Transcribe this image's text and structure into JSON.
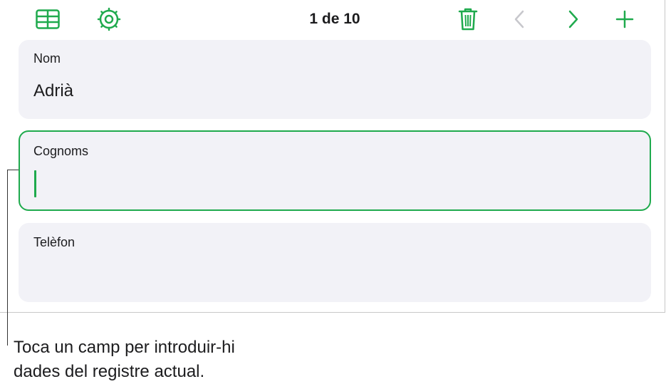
{
  "toolbar": {
    "record_counter": "1 de 10",
    "icons": {
      "table": "table-icon",
      "settings": "gear-icon",
      "delete": "trash-icon",
      "previous": "chevron-left-icon",
      "next": "chevron-right-icon",
      "add": "plus-icon"
    }
  },
  "fields": [
    {
      "label": "Nom",
      "value": "Adrià",
      "active": false
    },
    {
      "label": "Cognoms",
      "value": "",
      "active": true
    },
    {
      "label": "Telèfon",
      "value": "",
      "active": false
    }
  ],
  "callout": {
    "line1": "Toca un camp per introduir-hi",
    "line2": "dades del registre actual."
  },
  "colors": {
    "accent": "#1faa4d",
    "field_background": "#f2f2f7",
    "disabled": "#c7c7cc"
  }
}
